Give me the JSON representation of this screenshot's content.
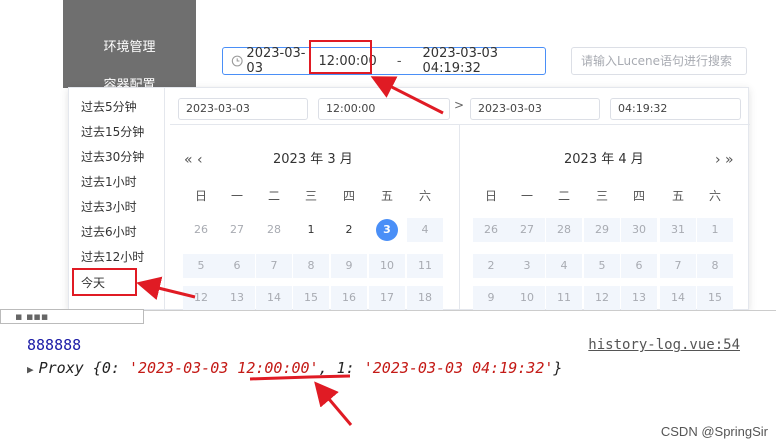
{
  "sidebar": {
    "items": [
      "环境管理",
      "容器配置"
    ]
  },
  "range_input": {
    "start_date": "2023-03-03",
    "start_time": "12:00:00",
    "separator": "-",
    "end": "2023-03-03 04:19:32"
  },
  "search": {
    "placeholder": "请输入Lucene语句进行搜索"
  },
  "picker": {
    "shortcuts": [
      "过去5分钟",
      "过去15分钟",
      "过去30分钟",
      "过去1小时",
      "过去3小时",
      "过去6小时",
      "过去12小时",
      "今天"
    ],
    "start_date": "2023-03-03",
    "start_time": "12:00:00",
    "arrow": ">",
    "end_date": "2023-03-03",
    "end_time": "04:19:32",
    "left": {
      "nav_prev_year": "«",
      "nav_prev_month": "‹",
      "title": "2023 年 3 月",
      "weekdays": [
        "日",
        "一",
        "二",
        "三",
        "四",
        "五",
        "六"
      ],
      "row1": [
        "26",
        "27",
        "28",
        "1",
        "2",
        "3",
        "4"
      ],
      "row2": [
        "5",
        "6",
        "7",
        "8",
        "9",
        "10",
        "11"
      ],
      "row3": [
        "12",
        "13",
        "14",
        "15",
        "16",
        "17",
        "18"
      ],
      "selected_day": "3"
    },
    "right": {
      "nav_next_month": "›",
      "nav_next_year": "»",
      "title": "2023 年 4 月",
      "weekdays": [
        "日",
        "一",
        "二",
        "三",
        "四",
        "五",
        "六"
      ],
      "row1": [
        "26",
        "27",
        "28",
        "29",
        "30",
        "31",
        "1"
      ],
      "row2": [
        "2",
        "3",
        "4",
        "5",
        "6",
        "7",
        "8"
      ],
      "row3": [
        "9",
        "10",
        "11",
        "12",
        "13",
        "14",
        "15"
      ]
    }
  },
  "console": {
    "log_value": "888888",
    "log_source": "history-log.vue:54",
    "proxy_prefix": "Proxy {0: ",
    "proxy_value0": "'2023-03-03 12:00:00'",
    "proxy_mid": ", 1: ",
    "proxy_value1": "'2023-03-03 04:19:32'",
    "proxy_suffix": "}"
  },
  "watermark": "CSDN @SpringSir",
  "colors": {
    "accent": "#4a8ff7",
    "annotation": "#e01b24",
    "string": "#c41a16",
    "log_blue": "#1a1aa6"
  }
}
